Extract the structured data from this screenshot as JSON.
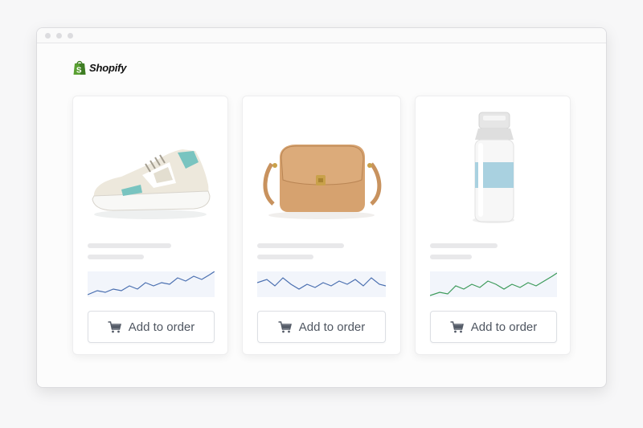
{
  "brand": {
    "name": "Shopify",
    "logo_icon": "shopping-bag-icon",
    "accent": "#5aa032"
  },
  "window": {
    "controls": [
      "close",
      "minimize",
      "maximize"
    ]
  },
  "products": [
    {
      "id": "sneaker",
      "image_icon": "sneaker-image",
      "button_label": "Add to order",
      "button_icon": "cart-icon",
      "trend_color": "#4a6fb0"
    },
    {
      "id": "handbag",
      "image_icon": "handbag-image",
      "button_label": "Add to order",
      "button_icon": "cart-icon",
      "trend_color": "#4a6fb0"
    },
    {
      "id": "water-bottle",
      "image_icon": "water-bottle-image",
      "button_label": "Add to order",
      "button_icon": "cart-icon",
      "trend_color": "#3c9a5a"
    }
  ]
}
